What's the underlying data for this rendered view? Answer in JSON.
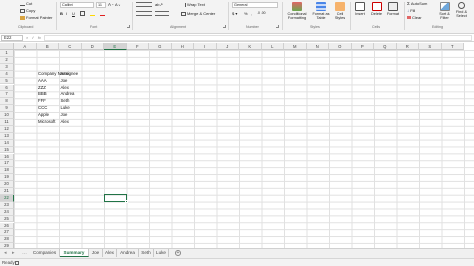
{
  "ribbon": {
    "clipboard": {
      "cut": "Cut",
      "copy": "Copy",
      "format_painter": "Format Painter",
      "group": "Clipboard"
    },
    "font": {
      "name": "Calibri",
      "size": "11",
      "group": "Font",
      "bold": "B",
      "italic": "I",
      "underline": "U"
    },
    "alignment": {
      "wrap_text": "Wrap Text",
      "merge_center": "Merge & Center",
      "group": "Alignment"
    },
    "number": {
      "format": "General",
      "group": "Number"
    },
    "styles": {
      "conditional": "Conditional Formatting",
      "format_table": "Format as Table",
      "cell_styles": "Cell Styles",
      "group": "Styles"
    },
    "cells": {
      "insert": "Insert",
      "delete": "Delete",
      "format": "Format",
      "group": "Cells"
    },
    "editing": {
      "autosum": "AutoSum",
      "fill": "Fill",
      "clear": "Clear",
      "sort_filter": "Sort & Filter",
      "find_select": "Find & Select",
      "group": "Editing"
    }
  },
  "formula_bar": {
    "name_box": "E22",
    "fx": "fx",
    "value": ""
  },
  "columns": [
    "A",
    "B",
    "C",
    "D",
    "E",
    "F",
    "G",
    "H",
    "I",
    "J",
    "K",
    "L",
    "M",
    "N",
    "O",
    "P",
    "Q",
    "R",
    "S",
    "T"
  ],
  "rows": [
    "1",
    "2",
    "3",
    "4",
    "5",
    "6",
    "7",
    "8",
    "9",
    "10",
    "11",
    "12",
    "13",
    "14",
    "15",
    "16",
    "17",
    "18",
    "19",
    "20",
    "21",
    "22",
    "23",
    "24",
    "25",
    "26",
    "27",
    "28",
    "29"
  ],
  "table": {
    "headers": [
      "Company Name",
      "Assignee"
    ],
    "rows": [
      [
        "AAA",
        "Joe"
      ],
      [
        "ZZZ",
        "Alex"
      ],
      [
        "BBB",
        "Andrea"
      ],
      [
        "FFF",
        "Seth"
      ],
      [
        "CCC",
        "Luke"
      ],
      [
        "Apple",
        "Joe"
      ],
      [
        "Microsoft",
        "Alex"
      ]
    ]
  },
  "sheet_tabs": [
    "Companies",
    "Summary",
    "Joe",
    "Alex",
    "Andrea",
    "Seth",
    "Luke"
  ],
  "active_sheet": "Summary",
  "status": {
    "text": "Ready"
  },
  "colors": {
    "accent": "#217346"
  }
}
